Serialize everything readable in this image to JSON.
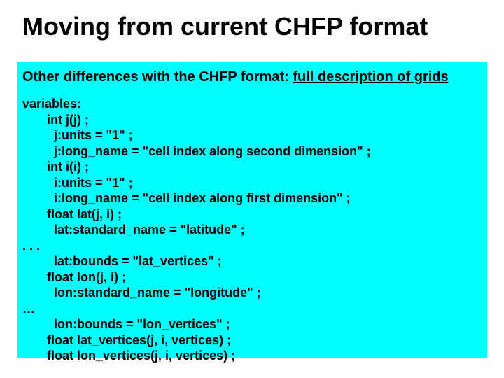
{
  "title": "Moving from current CHFP format",
  "subhead_prefix": "Other differences with the CHFP format: ",
  "subhead_underlined": "full description of grids",
  "code_lines": [
    "variables:",
    "       int j(j) ;",
    "         j:units = \"1\" ;",
    "         j:long_name = \"cell index along second dimension\" ;",
    "       int i(i) ;",
    "         i:units = \"1\" ;",
    "         i:long_name = \"cell index along first dimension\" ;",
    "       float lat(j, i) ;",
    "         lat:standard_name = \"latitude\" ;",
    ". . .",
    "         lat:bounds = \"lat_vertices\" ;",
    "       float lon(j, i) ;",
    "         lon:standard_name = \"longitude\" ;",
    "…",
    "         lon:bounds = \"lon_vertices\" ;",
    "       float lat_vertices(j, i, vertices) ;",
    "       float lon_vertices(j, i, vertices) ;"
  ]
}
